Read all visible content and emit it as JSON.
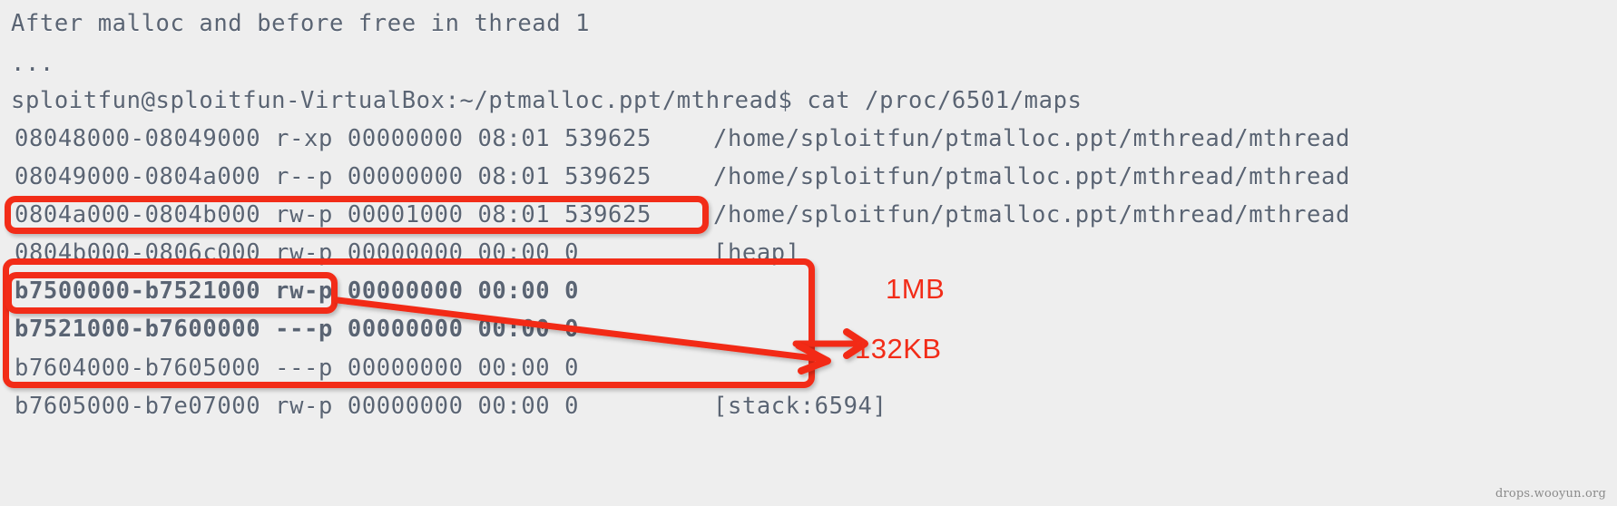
{
  "terminal": {
    "header": "After malloc and before free in thread 1",
    "ellipsis": "...",
    "prompt": "sploitfun@sploitfun-VirtualBox:~/ptmalloc.ppt/mthread$ cat /proc/6501/maps",
    "rows": [
      {
        "mapping": "08048000-08049000 r-xp 00000000 08:01 539625",
        "path": "/home/sploitfun/ptmalloc.ppt/mthread/mthread",
        "bold": false
      },
      {
        "mapping": "08049000-0804a000 r--p 00000000 08:01 539625",
        "path": "/home/sploitfun/ptmalloc.ppt/mthread/mthread",
        "bold": false
      },
      {
        "mapping": "0804a000-0804b000 rw-p 00001000 08:01 539625",
        "path": "/home/sploitfun/ptmalloc.ppt/mthread/mthread",
        "bold": false
      },
      {
        "mapping": "0804b000-0806c000 rw-p 00000000 00:00 0",
        "path": "[heap]",
        "bold": false
      },
      {
        "mapping": "b7500000-b7521000 rw-p 00000000 00:00 0",
        "path": "",
        "bold": true
      },
      {
        "mapping": "b7521000-b7600000 ---p 00000000 00:00 0",
        "path": "",
        "bold": true
      },
      {
        "mapping": "b7604000-b7605000 ---p 00000000 00:00 0",
        "path": "",
        "bold": false
      },
      {
        "mapping": "b7605000-b7e07000 rw-p 00000000 00:00 0",
        "path": "[stack:6594]",
        "bold": false
      }
    ]
  },
  "annotations": {
    "accent_color": "#f22c18",
    "text_color": "#5a6473",
    "background_color": "#eeeeee",
    "label_1mb": "1MB",
    "label_132kb": "132KB"
  },
  "watermark": {
    "text": "drops.wooyun.org"
  }
}
